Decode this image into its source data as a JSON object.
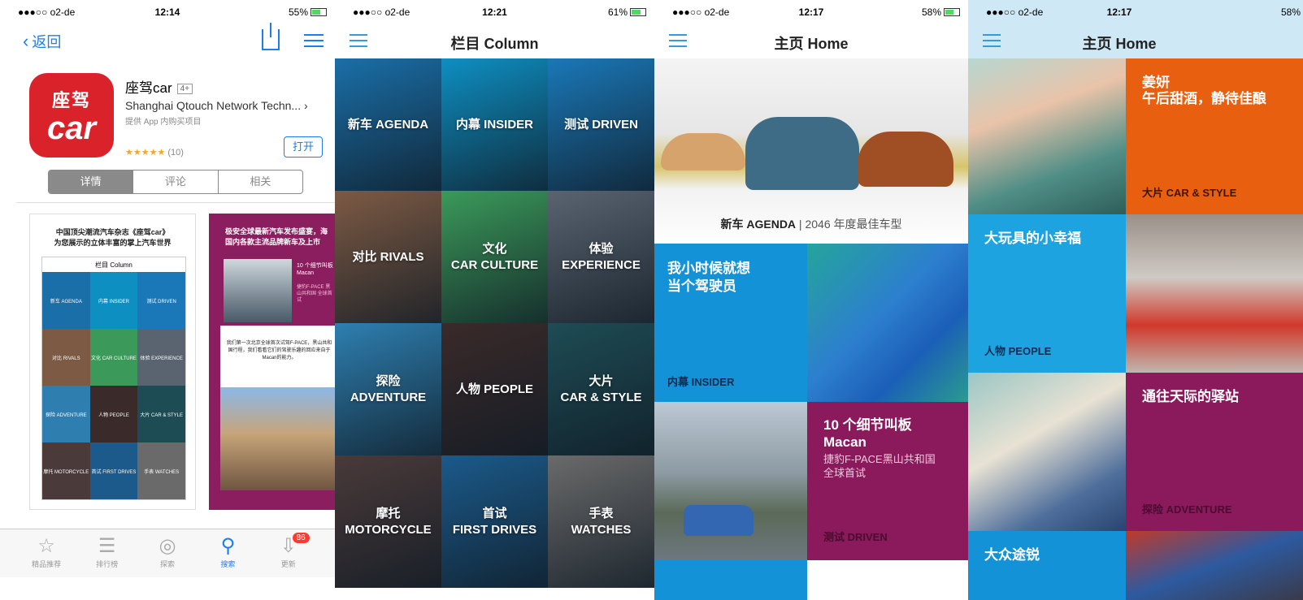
{
  "phone1": {
    "status": {
      "carrier": "●●●○○ o2-de ",
      "time": "12:14",
      "battery": "55%"
    },
    "back_label": "返回",
    "app": {
      "name": "座驾car",
      "age": "4+",
      "developer": "Shanghai Qtouch Network Techn... ›",
      "iap": "提供 App 内购买项目",
      "stars": "★★★★★",
      "rating_count": "(10)",
      "open_label": "打开",
      "icon_line1": "座驾",
      "icon_line2": "car"
    },
    "segments": [
      "详情",
      "评论",
      "相关"
    ],
    "shot1": {
      "caption_line1": "中国顶尖潮流汽车杂志《座驾car》",
      "caption_line2": "为您展示的立体丰富的掌上汽车世界",
      "mini_title": "栏目  Column",
      "mini_cells": [
        "新车 AGENDA",
        "内幕 INSIDER",
        "测试 DRIVEN",
        "对比 RIVALS",
        "文化 CAR CULTURE",
        "体验 EXPERIENCE",
        "探险 ADVENTURE",
        "人物 PEOPLE",
        "大片 CAR & STYLE",
        "摩托 MOTORCYCLE",
        "首试 FIRST DRIVES",
        "手表 WATCHES"
      ]
    },
    "shot2": {
      "caption_line1": "极安全球最新汽车发布盛宴，海",
      "caption_line2": "国内各款主流品牌新车及上市",
      "card_title": "10 个细节叫板 Macan",
      "card_sub": "捷豹F-PACE 黑山共和国 全球首试",
      "quote": "我们第一次北京全球首次试驾F-PACE，黑山共和国行程，我们看看它们的驾驶乐趣的回应来自于Macan的能力。"
    },
    "tabs": [
      {
        "label": "精品推荐",
        "icon": "☆"
      },
      {
        "label": "排行榜",
        "icon": "☰"
      },
      {
        "label": "探索",
        "icon": "◎"
      },
      {
        "label": "搜索",
        "icon": "⚲"
      },
      {
        "label": "更新",
        "icon": "⇩",
        "badge": "86"
      }
    ]
  },
  "phone2": {
    "status": {
      "carrier": "●●●○○ o2-de ",
      "time": "12:21",
      "battery": "61%"
    },
    "title": "栏目   Column",
    "cells": [
      {
        "label": "新车 AGENDA",
        "bg": "#1a6fa8"
      },
      {
        "label": "内幕 INSIDER",
        "bg": "#0e8fc2"
      },
      {
        "label": "测试 DRIVEN",
        "bg": "#1a78b8"
      },
      {
        "label": "对比 RIVALS",
        "bg": "#7d5a44"
      },
      {
        "label": "文化\nCAR CULTURE",
        "bg": "#3b9a5a"
      },
      {
        "label": "体验\nEXPERIENCE",
        "bg": "#5a6470"
      },
      {
        "label": "探险\nADVENTURE",
        "bg": "#2e7fb0"
      },
      {
        "label": "人物 PEOPLE",
        "bg": "#3a2a2a"
      },
      {
        "label": "大片\nCAR & STYLE",
        "bg": "#1e4c55"
      },
      {
        "label": "摩托\nMOTORCYCLE",
        "bg": "#4a3a3a"
      },
      {
        "label": "首试\nFIRST DRIVES",
        "bg": "#1b5a8a"
      },
      {
        "label": "手表\nWATCHES",
        "bg": "#6a6a6a"
      }
    ]
  },
  "phone3": {
    "status": {
      "carrier": "●●●○○ o2-de ",
      "time": "12:17",
      "battery": "58%"
    },
    "title": "主页   Home",
    "hero_tag": "新车 AGENDA",
    "hero_sep": " | ",
    "hero_text": "2046 年度最佳车型",
    "blue_text": "我小时候就想\n当个驾驶员",
    "blue_tag": "内幕 INSIDER",
    "purple_title": "10 个细节叫板\nMacan",
    "purple_sub": "捷豹F-PACE黑山共和国\n全球首试",
    "purple_tag": "测试 DRIVEN"
  },
  "phone4": {
    "status": {
      "carrier": "●●●○○ o2-de ",
      "time": "12:17",
      "battery": "58%"
    },
    "title": "主页   Home",
    "orange_title": "姜妍\n午后甜酒，静待佳酿",
    "orange_tag": "大片 CAR & STYLE",
    "blue_title": "大玩具的小幸福",
    "blue_tag": "人物 PEOPLE",
    "purple_title": "通往天际的驿站",
    "purple_tag": "探险 ADVENTURE",
    "bottom_title": "大众途锐"
  }
}
